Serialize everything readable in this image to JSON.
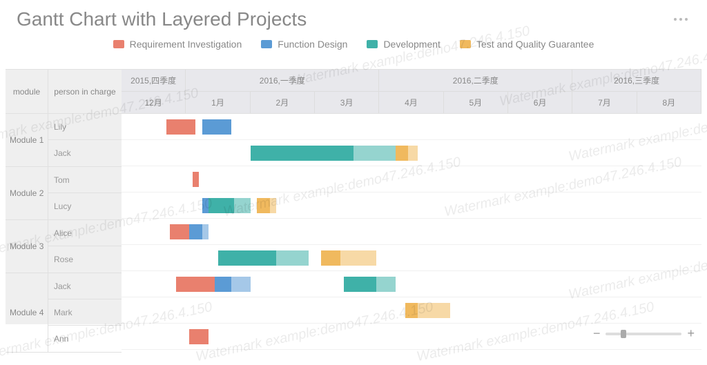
{
  "title": "Gantt Chart with Layered Projects",
  "legend": [
    {
      "label": "Requirement Investigation",
      "color": "#e9806e"
    },
    {
      "label": "Function Design",
      "color": "#5b9bd5"
    },
    {
      "label": "Development",
      "color": "#3fb1a8"
    },
    {
      "label": "Test and Quality Guarantee",
      "color": "#f0b95e"
    }
  ],
  "left_headers": {
    "module": "module",
    "person": "person in charge"
  },
  "quarters": [
    {
      "label": "2015,四季度",
      "span": 1
    },
    {
      "label": "2016,一季度",
      "span": 3
    },
    {
      "label": "2016,二季度",
      "span": 3
    },
    {
      "label": "2016,三季度",
      "span": 2
    }
  ],
  "months": [
    "12月",
    "1月",
    "2月",
    "3月",
    "4月",
    "5月",
    "6月",
    "7月",
    "8月"
  ],
  "modules": [
    {
      "name": "Module 1",
      "persons": [
        "Lily",
        "Jack"
      ]
    },
    {
      "name": "Module 2",
      "persons": [
        "Tom",
        "Lucy"
      ]
    },
    {
      "name": "Module 3",
      "persons": [
        "Alice",
        "Rose"
      ]
    },
    {
      "name": "Module 4",
      "persons": [
        "Jack",
        "Mark",
        "Ann"
      ]
    }
  ],
  "watermark_text": "Watermark example:demo47.246.4.150",
  "chart_data": {
    "type": "gantt",
    "x_unit": "month",
    "x_months": [
      "2015-12",
      "2016-01",
      "2016-02",
      "2016-03",
      "2016-04",
      "2016-05",
      "2016-06",
      "2016-07",
      "2016-08"
    ],
    "phases": [
      "Requirement Investigation",
      "Function Design",
      "Development",
      "Test and Quality Guarantee"
    ],
    "phase_colors": {
      "Requirement Investigation": "#e9806e",
      "Function Design": "#5b9bd5",
      "Development": "#3fb1a8",
      "Test and Quality Guarantee": "#f0b95e"
    },
    "rows": [
      {
        "module": "Module 1",
        "person": "Lily",
        "segments": [
          {
            "phase": "Requirement Investigation",
            "start": 0.7,
            "end": 1.15
          },
          {
            "phase": "Function Design",
            "start": 1.25,
            "end": 1.7
          }
        ]
      },
      {
        "module": "Module 1",
        "person": "Jack",
        "segments": [
          {
            "phase": "Development",
            "start": 2.0,
            "end": 3.6
          },
          {
            "phase": "Development",
            "start": 3.6,
            "end": 4.25,
            "shade": "light"
          },
          {
            "phase": "Test and Quality Guarantee",
            "start": 4.25,
            "end": 4.45
          },
          {
            "phase": "Test and Quality Guarantee",
            "start": 4.45,
            "end": 4.6,
            "shade": "light"
          }
        ]
      },
      {
        "module": "Module 2",
        "person": "Tom",
        "segments": [
          {
            "phase": "Requirement Investigation",
            "start": 1.1,
            "end": 1.2
          }
        ]
      },
      {
        "module": "Module 2",
        "person": "Lucy",
        "segments": [
          {
            "phase": "Function Design",
            "start": 1.25,
            "end": 1.35
          },
          {
            "phase": "Development",
            "start": 1.35,
            "end": 1.75
          },
          {
            "phase": "Development",
            "start": 1.75,
            "end": 2.0,
            "shade": "light"
          },
          {
            "phase": "Test and Quality Guarantee",
            "start": 2.1,
            "end": 2.3
          },
          {
            "phase": "Test and Quality Guarantee",
            "start": 2.3,
            "end": 2.4,
            "shade": "light"
          }
        ]
      },
      {
        "module": "Module 3",
        "person": "Alice",
        "segments": [
          {
            "phase": "Requirement Investigation",
            "start": 0.75,
            "end": 1.05
          },
          {
            "phase": "Function Design",
            "start": 1.05,
            "end": 1.25
          },
          {
            "phase": "Function Design",
            "start": 1.25,
            "end": 1.35,
            "shade": "light"
          }
        ]
      },
      {
        "module": "Module 3",
        "person": "Rose",
        "segments": [
          {
            "phase": "Development",
            "start": 1.5,
            "end": 2.4
          },
          {
            "phase": "Development",
            "start": 2.4,
            "end": 2.9,
            "shade": "light"
          },
          {
            "phase": "Test and Quality Guarantee",
            "start": 3.1,
            "end": 3.4
          },
          {
            "phase": "Test and Quality Guarantee",
            "start": 3.4,
            "end": 3.95,
            "shade": "light"
          }
        ]
      },
      {
        "module": "Module 4",
        "person": "Jack",
        "segments": [
          {
            "phase": "Requirement Investigation",
            "start": 0.85,
            "end": 1.45
          },
          {
            "phase": "Function Design",
            "start": 1.45,
            "end": 1.7
          },
          {
            "phase": "Function Design",
            "start": 1.7,
            "end": 2.0,
            "shade": "light"
          },
          {
            "phase": "Development",
            "start": 3.45,
            "end": 3.95
          },
          {
            "phase": "Development",
            "start": 3.95,
            "end": 4.25,
            "shade": "light"
          }
        ]
      },
      {
        "module": "Module 4",
        "person": "Mark",
        "segments": [
          {
            "phase": "Test and Quality Guarantee",
            "start": 4.4,
            "end": 4.6
          },
          {
            "phase": "Test and Quality Guarantee",
            "start": 4.6,
            "end": 5.1,
            "shade": "light"
          }
        ]
      },
      {
        "module": "Module 4",
        "person": "Ann",
        "segments": [
          {
            "phase": "Requirement Investigation",
            "start": 1.05,
            "end": 1.35
          }
        ]
      }
    ]
  }
}
